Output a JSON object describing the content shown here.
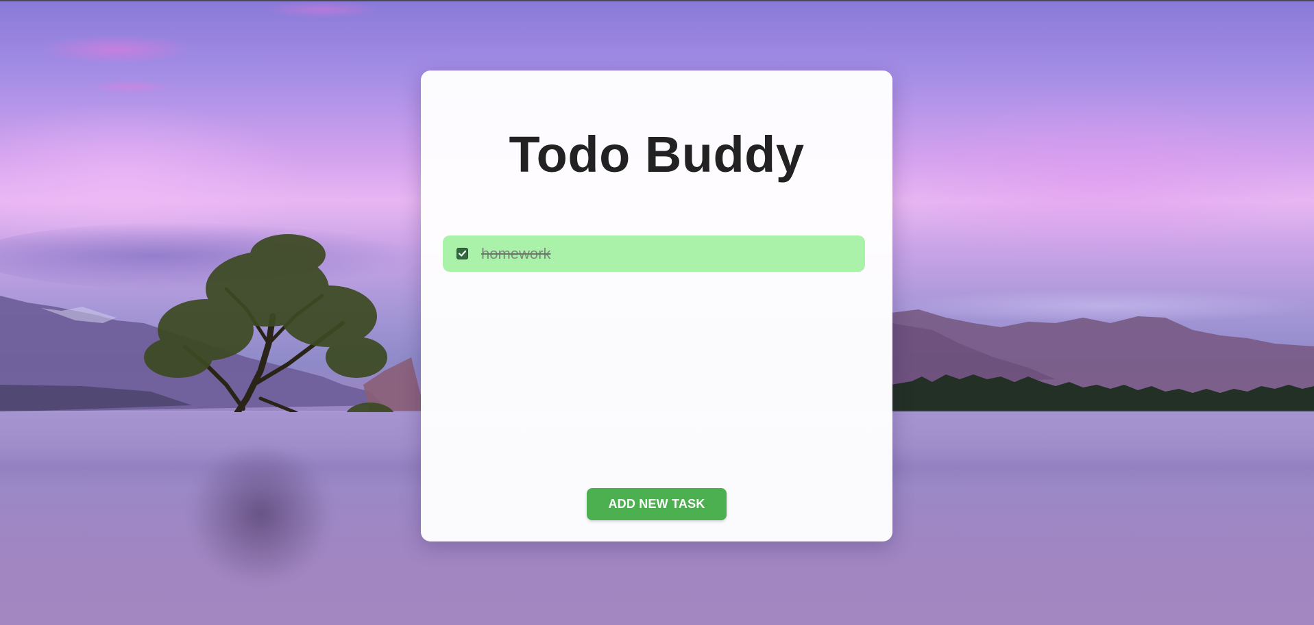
{
  "app": {
    "title": "Todo Buddy"
  },
  "tasks": [
    {
      "text": "homework",
      "completed": true
    }
  ],
  "actions": {
    "add_label": "ADD NEW TASK"
  },
  "colors": {
    "task_done_bg": "#aaf2aa",
    "button_bg": "#4caf50",
    "title_color": "#222222"
  },
  "icons": {
    "checkbox": "checkmark-icon"
  }
}
